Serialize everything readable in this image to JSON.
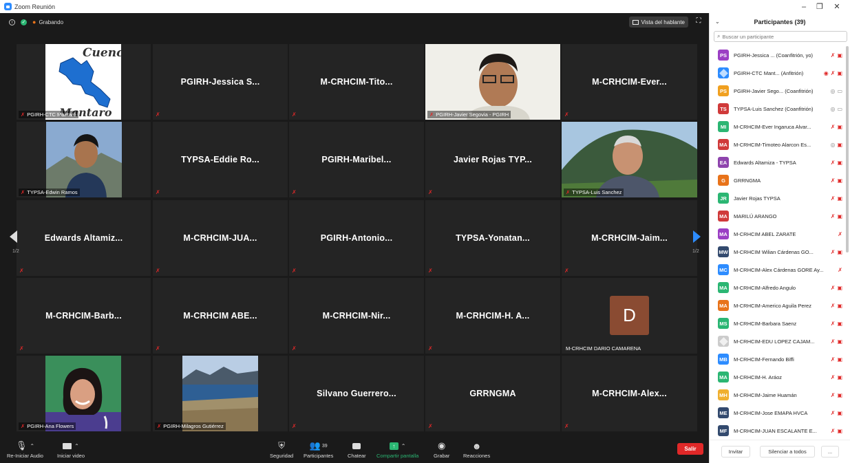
{
  "window": {
    "title": "Zoom Reunión",
    "min": "–",
    "max": "❐",
    "close": "✕"
  },
  "topbar": {
    "info": "i",
    "shield": "✓",
    "rec_dot": "●",
    "recording_label": "Grabando",
    "view_label": "Vista del hablante",
    "fullscreen": "⛶"
  },
  "tiles": [
    {
      "type": "image",
      "label": "PGIRH-CTC Mantaro",
      "img": "map"
    },
    {
      "type": "name",
      "name": "PGIRH-Jessica S..."
    },
    {
      "type": "name",
      "name": "M-CRHCIM-Tito..."
    },
    {
      "type": "image",
      "label": "PGIRH-Javier Segovia - PGIRH",
      "img": "man1"
    },
    {
      "type": "name",
      "name": "M-CRHCIM-Ever..."
    },
    {
      "type": "image",
      "label": "TYPSA-Edwin Ramos",
      "img": "man2"
    },
    {
      "type": "name",
      "name": "TYPSA-Eddie Ro..."
    },
    {
      "type": "name",
      "name": "PGIRH-Maribel..."
    },
    {
      "type": "name",
      "name": "Javier Rojas TYP..."
    },
    {
      "type": "image",
      "label": "TYPSA-Luis Sanchez",
      "img": "man3",
      "active": true
    },
    {
      "type": "name",
      "name": "Edwards Altamiz..."
    },
    {
      "type": "name",
      "name": "M-CRHCIM-JUA..."
    },
    {
      "type": "name",
      "name": "PGIRH-Antonio..."
    },
    {
      "type": "name",
      "name": "TYPSA-Yonatan..."
    },
    {
      "type": "name",
      "name": "M-CRHCIM-Jaim..."
    },
    {
      "type": "name",
      "name": "M-CRHCIM-Barb..."
    },
    {
      "type": "name",
      "name": "M-CRHCIM ABE..."
    },
    {
      "type": "name",
      "name": "M-CRHCIM-Nir..."
    },
    {
      "type": "name",
      "name": "M-CRHCIM-H. A..."
    },
    {
      "type": "letter",
      "letter": "D",
      "label": "M-CRHCIM DARIO CAMARENA"
    },
    {
      "type": "image",
      "label": "PGIRH-Ana Flowers",
      "img": "woman"
    },
    {
      "type": "image",
      "label": "PGIRH-Milagros Gutiérrez",
      "img": "landscape"
    },
    {
      "type": "name",
      "name": "Silvano Guerrero..."
    },
    {
      "type": "name",
      "name": "GRRNGMA"
    },
    {
      "type": "name",
      "name": "M-CRHCIM-Alex..."
    }
  ],
  "map_text": {
    "top": "Cuenc",
    "bottom": "Mantaro"
  },
  "page": {
    "left": "1/2",
    "right": "1/2"
  },
  "toolbar": {
    "audio": "Re-Iniciar Audio",
    "video": "Iniciar video",
    "security": "Seguridad",
    "participants": "Participantes",
    "participants_count": "39",
    "chat": "Chatear",
    "share": "Compartir pantalla",
    "record": "Grabar",
    "reactions": "Reacciones",
    "leave": "Salir"
  },
  "panel": {
    "title": "Participantes (39)",
    "search_placeholder": "Buscar un participante",
    "invite": "Invitar",
    "mute_all": "Silenciar a todos",
    "more": "..."
  },
  "participants": [
    {
      "initials": "PS",
      "color": "#9b3fc4",
      "name": "PGIRH-Jessica ...  (Coanfitrión, yo)",
      "icons": "mic-off video-off"
    },
    {
      "initials": "",
      "color": "#2d8cff",
      "name": "PGIRH-CTC Mant...  (Anfitrión)",
      "icons": "rec mic-off video-off",
      "img": true
    },
    {
      "initials": "PS",
      "color": "#f0a020",
      "name": "PGIRH-Javier Sego...  (Coanfitrión)",
      "icons": "mic video"
    },
    {
      "initials": "TS",
      "color": "#d03a3a",
      "name": "TYPSA-Luis Sanchez  (Coanfitrión)",
      "icons": "mic video"
    },
    {
      "initials": "MI",
      "color": "#2bb673",
      "name": "M-CRHCIM-Ever Ingaruca Alvar...",
      "icons": "mic-off video-off"
    },
    {
      "initials": "MA",
      "color": "#d03a3a",
      "name": "M-CRHCIM-Timoteo Alarcon Es...",
      "icons": "mic video-off"
    },
    {
      "initials": "EA",
      "color": "#8e44ad",
      "name": "Edwards Altamiza - TYPSA",
      "icons": "mic-off video-off"
    },
    {
      "initials": "G",
      "color": "#e8731a",
      "name": "GRRNGMA",
      "icons": "mic-off video-off"
    },
    {
      "initials": "JR",
      "color": "#2bb673",
      "name": "Javier Rojas TYPSA",
      "icons": "mic-off video-off"
    },
    {
      "initials": "MA",
      "color": "#d03a3a",
      "name": "MARILÚ ARANGO",
      "icons": "mic-off video-off"
    },
    {
      "initials": "MA",
      "color": "#9b3fc4",
      "name": "M-CRHCIM ABEL ZARATE",
      "icons": "mic-off"
    },
    {
      "initials": "MW",
      "color": "#334a6e",
      "name": "M-CRHCIM Wilian Cárdenas GO...",
      "icons": "mic-off video-off"
    },
    {
      "initials": "MC",
      "color": "#2d8cff",
      "name": "M-CRHCIM-Alex Cárdenas GORE Ay...",
      "icons": "mic-off"
    },
    {
      "initials": "MA",
      "color": "#2bb673",
      "name": "M-CRHCIM-Alfredo Angulo",
      "icons": "mic-off video-off"
    },
    {
      "initials": "MA",
      "color": "#e8731a",
      "name": "M-CRHCIM-Americo Aguila Perez",
      "icons": "mic-off video-off"
    },
    {
      "initials": "MS",
      "color": "#2bb673",
      "name": "M-CRHCIM-Barbara Saenz",
      "icons": "mic-off video-off"
    },
    {
      "initials": "",
      "color": "#cccccc",
      "name": "M-CRHCIM-EDU LOPEZ CAJAM...",
      "icons": "mic-off video-off",
      "img": true
    },
    {
      "initials": "MB",
      "color": "#2d8cff",
      "name": "M-CRHCIM-Fernando Biffi",
      "icons": "mic-off video-off"
    },
    {
      "initials": "MA",
      "color": "#2bb673",
      "name": "M-CRHCIM-H. Aráoz",
      "icons": "mic-off video-off"
    },
    {
      "initials": "MH",
      "color": "#f0b030",
      "name": "M-CRHCIM-Jaime Huamán",
      "icons": "mic-off video-off"
    },
    {
      "initials": "ME",
      "color": "#334a6e",
      "name": "M-CRHCIM-Jose EMAPA HVCA",
      "icons": "mic-off video-off"
    },
    {
      "initials": "MF",
      "color": "#334a6e",
      "name": "M-CRHCIM-JUAN ESCALANTE E...",
      "icons": "mic-off video-off"
    }
  ]
}
